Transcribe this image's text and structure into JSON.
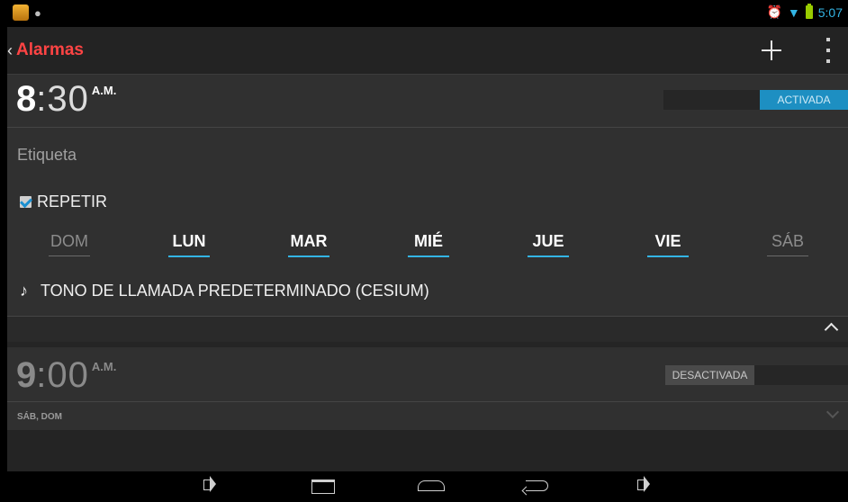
{
  "status_bar": {
    "time": "5:07",
    "icons": [
      "app-icon",
      "cat-icon",
      "alarm-clock-icon",
      "wifi-icon",
      "battery-icon"
    ]
  },
  "action_bar": {
    "back_glyph": "‹",
    "title": "Alarmas"
  },
  "alarms": [
    {
      "hour": "8",
      "minutes": ":30",
      "ampm": "A.M.",
      "toggle_label": "ACTIVADA",
      "enabled": true,
      "label_placeholder": "Etiqueta",
      "repeat_label": "REPETIR",
      "repeat_checked": true,
      "days": [
        {
          "label": "DOM",
          "selected": false
        },
        {
          "label": "LUN",
          "selected": true
        },
        {
          "label": "MAR",
          "selected": true
        },
        {
          "label": "MIÉ",
          "selected": true
        },
        {
          "label": "JUE",
          "selected": true
        },
        {
          "label": "VIE",
          "selected": true
        },
        {
          "label": "SÁB",
          "selected": false
        }
      ],
      "ringtone_glyph": "♪",
      "ringtone": "TONO DE LLAMADA PREDETERMINADO (CESIUM)"
    },
    {
      "hour": "9",
      "minutes": ":00",
      "ampm": "A.M.",
      "toggle_label": "DESACTIVADA",
      "enabled": false,
      "repeat_days": "SÁB, DOM"
    }
  ],
  "colors": {
    "accent": "#33b5e5",
    "title": "#ff4444",
    "toggle_on": "#1d8fc2",
    "background": "#303030"
  }
}
